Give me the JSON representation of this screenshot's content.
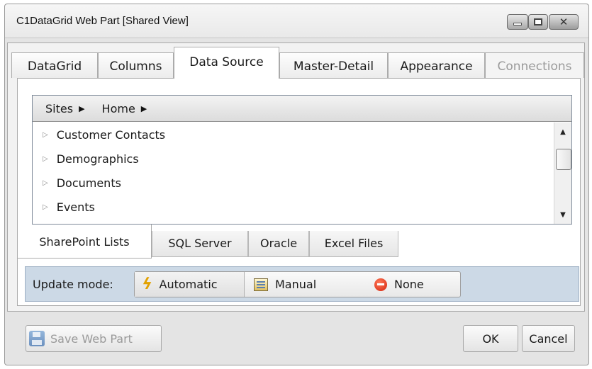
{
  "window": {
    "title": "C1DataGrid Web Part [Shared View]"
  },
  "tabs": [
    {
      "label": "DataGrid",
      "state": "normal"
    },
    {
      "label": "Columns",
      "state": "normal"
    },
    {
      "label": "Data Source",
      "state": "active"
    },
    {
      "label": "Master-Detail",
      "state": "normal"
    },
    {
      "label": "Appearance",
      "state": "normal"
    },
    {
      "label": "Connections",
      "state": "disabled"
    }
  ],
  "breadcrumb": [
    {
      "label": "Sites"
    },
    {
      "label": "Home"
    }
  ],
  "list": {
    "items": [
      {
        "label": "Customer Contacts"
      },
      {
        "label": "Demographics"
      },
      {
        "label": "Documents"
      },
      {
        "label": "Events"
      }
    ]
  },
  "source_tabs": [
    {
      "label": "SharePoint Lists",
      "state": "active"
    },
    {
      "label": "SQL Server",
      "state": "normal"
    },
    {
      "label": "Oracle",
      "state": "normal"
    },
    {
      "label": "Excel Files",
      "state": "normal"
    }
  ],
  "update_mode": {
    "label": "Update mode:",
    "options": [
      {
        "label": "Automatic",
        "icon": "lightning-bolt-icon"
      },
      {
        "label": "Manual",
        "icon": "manual-edit-icon"
      },
      {
        "label": "None",
        "icon": "none-stop-icon"
      }
    ],
    "selected": "Automatic"
  },
  "footer": {
    "save_label": "Save Web Part",
    "ok_label": "OK",
    "cancel_label": "Cancel"
  },
  "colors": {
    "update_bar_bg": "#ccd9e6",
    "disabled_text": "#9a9a9a",
    "bolt": "#e2a100",
    "none_icon": "#d4210a"
  }
}
